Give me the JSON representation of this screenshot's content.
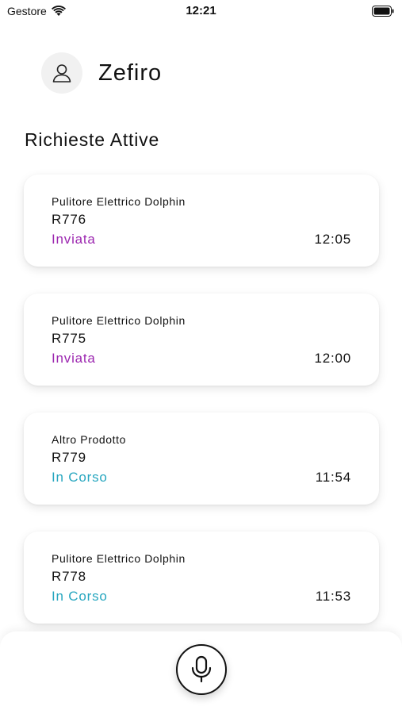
{
  "status_bar": {
    "carrier": "Gestore",
    "time": "12:21"
  },
  "profile": {
    "name": "Zefiro",
    "avatar_icon": "user-icon"
  },
  "section": {
    "title": "Richieste Attive"
  },
  "colors": {
    "inviata": "#9c27b0",
    "in_corso": "#26a6bf"
  },
  "requests": [
    {
      "product": "Pulitore Elettrico Dolphin",
      "code": "R776",
      "status": "Inviata",
      "status_color": "#9c27b0",
      "time": "12:05"
    },
    {
      "product": "Pulitore Elettrico Dolphin",
      "code": "R775",
      "status": "Inviata",
      "status_color": "#9c27b0",
      "time": "12:00"
    },
    {
      "product": "Altro Prodotto",
      "code": "R779",
      "status": "In Corso",
      "status_color": "#26a6bf",
      "time": "11:54"
    },
    {
      "product": "Pulitore Elettrico Dolphin",
      "code": "R778",
      "status": "In Corso",
      "status_color": "#26a6bf",
      "time": "11:53"
    }
  ],
  "bottom_bar": {
    "mic_icon": "microphone-icon"
  }
}
